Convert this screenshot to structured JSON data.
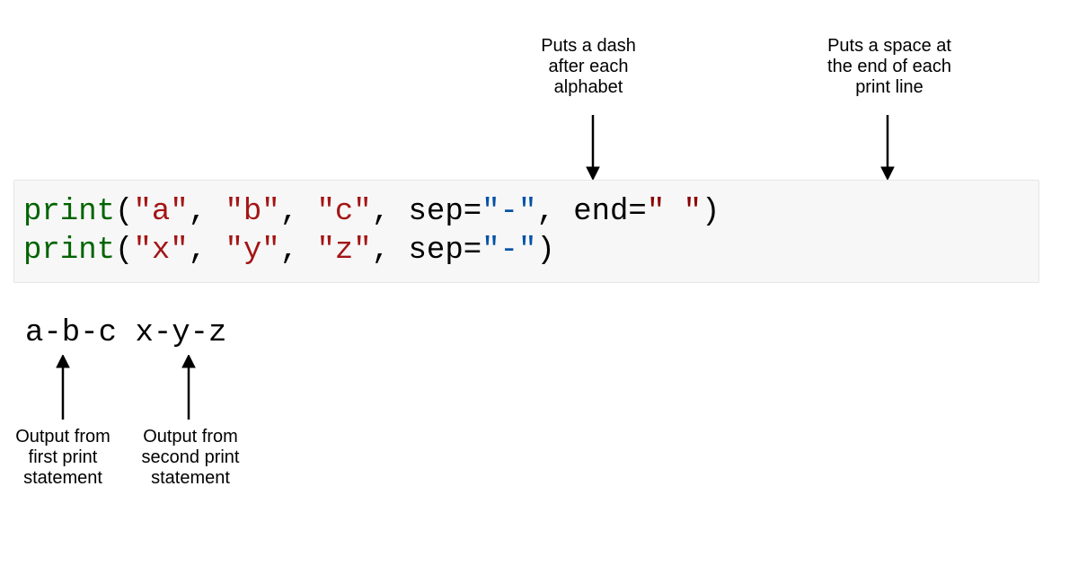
{
  "annotations": {
    "sep_note": "Puts a dash\nafter each\nalphabet",
    "end_note": "Puts a space at\nthe end of each\nprint line",
    "out1_note": "Output from\nfirst print\nstatement",
    "out2_note": "Output from\nsecond print\nstatement"
  },
  "code": {
    "line1": {
      "fn": "print",
      "open": "(",
      "a": "\"a\"",
      "c1": ", ",
      "b": "\"b\"",
      "c2": ", ",
      "c": "\"c\"",
      "c3": ", ",
      "sep_kw": "sep",
      "eq1": "=",
      "sep_val": "\"-\"",
      "c4": ", ",
      "end_kw": "end",
      "eq2": "=",
      "end_val": "\" \"",
      "close": ")"
    },
    "line2": {
      "fn": "print",
      "open": "(",
      "x": "\"x\"",
      "c1": ", ",
      "y": "\"y\"",
      "c2": ", ",
      "z": "\"z\"",
      "c3": ", ",
      "sep_kw": "sep",
      "eq1": "=",
      "sep_val": "\"-\"",
      "close": ")"
    }
  },
  "output": {
    "part1": "a-b-c",
    "spacer": " ",
    "part2": "x-y-z"
  }
}
